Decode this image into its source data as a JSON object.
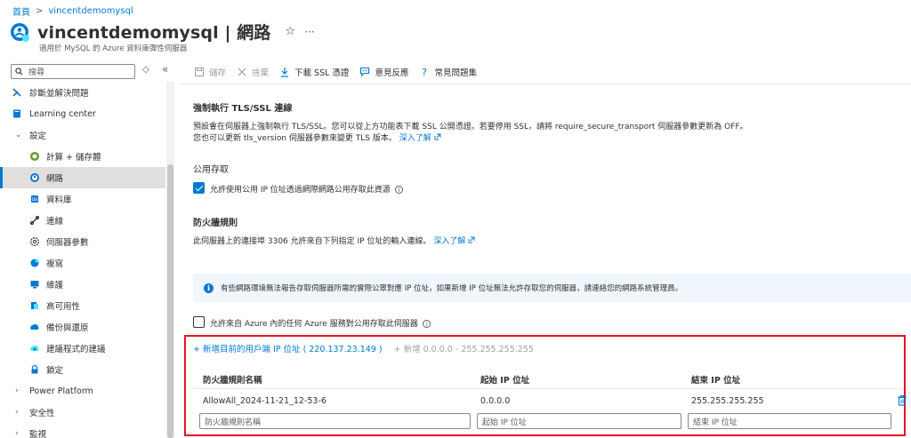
{
  "breadcrumb": {
    "home": "首頁",
    "sep": ">",
    "current": "vincentdemomysql"
  },
  "header": {
    "title": "vincentdemomysql | 網路",
    "subtitle": "適用於 MySQL 的 Azure 資料庫彈性伺服器",
    "star": "☆",
    "more": "···"
  },
  "search": {
    "placeholder": "搜尋"
  },
  "nav_controls": {
    "collapse": "«",
    "refresh": "◇"
  },
  "nav": {
    "items": [
      {
        "label": "診斷並解決問題",
        "icon": "wrench-icon"
      },
      {
        "label": "Learning center",
        "icon": "learning-icon"
      },
      {
        "label": "設定",
        "icon": "chevron-down-icon",
        "expanded": true
      },
      {
        "label": "計算 + 儲存體",
        "icon": "compute-icon"
      },
      {
        "label": "網路",
        "icon": "network-icon",
        "selected": true
      },
      {
        "label": "資料庫",
        "icon": "database-icon"
      },
      {
        "label": "連線",
        "icon": "connect-icon"
      },
      {
        "label": "伺服器參數",
        "icon": "gear-icon"
      },
      {
        "label": "複寫",
        "icon": "replication-icon"
      },
      {
        "label": "維護",
        "icon": "maintenance-icon"
      },
      {
        "label": "高可用性",
        "icon": "high-availability-icon"
      },
      {
        "label": "備份與還原",
        "icon": "backup-icon"
      },
      {
        "label": "建議程式的建議",
        "icon": "advisor-icon"
      },
      {
        "label": "鎖定",
        "icon": "lock-icon"
      },
      {
        "label": "Power Platform",
        "icon": "chevron-right-icon"
      },
      {
        "label": "安全性",
        "icon": "chevron-right-icon"
      },
      {
        "label": "監視",
        "icon": "chevron-right-icon"
      }
    ]
  },
  "toolbar": {
    "save": "儲存",
    "discard": "捨棄",
    "download_ssl": "下載 SSL 憑證",
    "feedback": "意見反應",
    "faq": "常見問題集"
  },
  "tls": {
    "title": "強制執行 TLS/SSL 連線",
    "line1": "預設會在伺服器上強制執行 TLS/SSL。您可以從上方功能表下載 SSL 公開憑證。若要停用 SSL，請將 require_secure_transport 伺服器參數更新為 OFF。",
    "line2": "您也可以更新 tls_version 伺服器參數來變更 TLS 版本。",
    "learn_more": "深入了解"
  },
  "public_access": {
    "title": "公用存取",
    "checkbox_label": "允許使用公用 IP 位址透過網際網路公用存取此資源",
    "checked": true
  },
  "firewall": {
    "title": "防火牆規則",
    "desc": "此伺服器上的連接埠 3306 允許來自下列指定 IP 位址的輸入連線。",
    "learn_more": "深入了解"
  },
  "banner": {
    "text": "有些網路環境無法報告存取伺服器所需的實際公眾對應 IP 位址，如果新增 IP 位址無法允許存取您的伺服器，請連絡您的網路系統管理員。"
  },
  "azure_access": {
    "label": "允許來自 Azure 內的任何 Azure 服務對公用存取此伺服器",
    "checked": false
  },
  "add_links": {
    "add_client": "+ 新增目前的用戶端 IP 位址 ( 220.137.23.149 )",
    "add_all": "+ 新增 0.0.0.0 - 255.255.255.255"
  },
  "table": {
    "headers": [
      "防火牆規則名稱",
      "起始 IP 位址",
      "結束 IP 位址"
    ],
    "rows": [
      [
        "AllowAll_2024-11-21_12-53-6",
        "0.0.0.0",
        "255.255.255.255"
      ]
    ],
    "placeholders": [
      "防火牆規則名稱",
      "起始 IP 位址",
      "結束 IP 位址"
    ]
  },
  "colors": {
    "accent": "#0078d4",
    "highlight_border": "#e81123"
  }
}
